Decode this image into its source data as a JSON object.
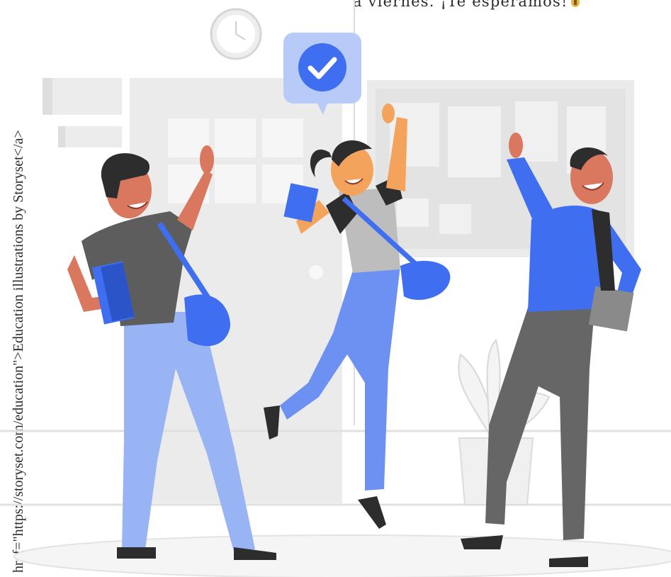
{
  "caption": {
    "text": "a viernes.  ¡Te esperamos!",
    "emoji": "waving-hand-icon"
  },
  "attribution": {
    "text": "href=\"https://storyset.com/education\">Education illustrations by Storyset</a>"
  },
  "badge": {
    "icon": "check-circle-icon"
  },
  "colors": {
    "accent_blue": "#3f6ff0",
    "light_blue": "#98b4f4",
    "dark_gray": "#5d5d5d",
    "wall_gray": "#ebebeb",
    "skin": "#d9785f",
    "hair": "#2d2d2d"
  }
}
